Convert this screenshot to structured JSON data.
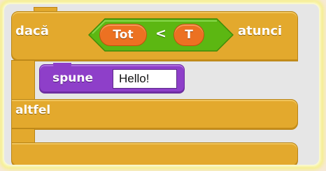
{
  "if_block": {
    "if_label": "dacă",
    "then_label": "atunci",
    "else_label": "altfel"
  },
  "condition": {
    "left": "Tot",
    "operator": "<",
    "right": "T"
  },
  "say_block": {
    "label": "spune",
    "value": "Hello!"
  },
  "colors": {
    "control": "#e3a92d",
    "operator": "#5cb712",
    "variable": "#ec7122",
    "looks": "#8e3fc9"
  }
}
